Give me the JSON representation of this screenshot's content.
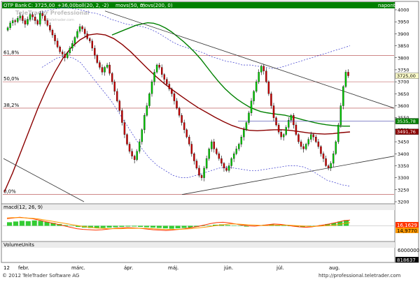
{
  "header": {
    "instrument": "OTP Bank",
    "close_text": "C: 3725,00",
    "change_text": "+36,00",
    "boll_text": "boll(20, 2, -2)",
    "movs_text": "movs(50, 0)",
    "movs2_text": "movs(200, 0)",
    "period": "naponta"
  },
  "watermark": {
    "line1": "TeleTrader Professional",
    "line2": "http://professional.teletrader.com"
  },
  "colors": {
    "background": "#ffffff",
    "header_bar": "#008000",
    "header_text": "#ffffff",
    "up_candle": "#00cc00",
    "down_candle": "#cc0000",
    "ma50": "#008000",
    "ma200": "#8b0000",
    "bollinger": "#3333cc",
    "trendline": "#333333",
    "macd": "#ff3300",
    "macd_signal": "#ff9900",
    "macd_hist": "#33cc33",
    "price_label_bg": "#ffffcc"
  },
  "fib_labels": [
    "61,8%",
    "50,0%",
    "38,2%",
    "0,0%"
  ],
  "price_tags": [
    {
      "text": "3725,00",
      "bg": "#ffffcc",
      "color": "#000000"
    },
    {
      "text": "3535,78",
      "bg": "#008000",
      "color": "#ffffff"
    },
    {
      "text": "3491,76",
      "bg": "#8b0000",
      "color": "#ffffff"
    }
  ],
  "macd_panel": {
    "label": "macd(12, 26, 9)",
    "tag1": "16,1629",
    "tag2": "14,9770"
  },
  "volume_panel": {
    "label": "VolumeUnits",
    "axis_top": "6000000",
    "tag": "818637"
  },
  "x_axis_labels": [
    "12",
    "febr.",
    "márc.",
    "ápr.",
    "máj.",
    "jún.",
    "júl.",
    "aug."
  ],
  "footer": {
    "left": "© 2012 TeleTrader Software AG",
    "right": "http://professional.teletrader.com"
  },
  "chart_data": {
    "type": "candlestick",
    "title": "OTP Bank",
    "ylim": [
      3200,
      4000
    ],
    "y_ticks": [
      3200,
      3250,
      3300,
      3350,
      3400,
      3450,
      3500,
      3550,
      3600,
      3650,
      3700,
      3750,
      3800,
      3850,
      3900,
      3950,
      4000
    ],
    "fib_levels": [
      {
        "label": "61,8%",
        "value": 3810
      },
      {
        "label": "50,0%",
        "value": 3700
      },
      {
        "label": "38,2%",
        "value": 3590
      },
      {
        "label": "0,0%",
        "value": 3230
      }
    ],
    "close_series": [
      3925,
      3945,
      3955,
      3950,
      3965,
      3975,
      3955,
      3940,
      3960,
      3980,
      3970,
      3955,
      3940,
      3985,
      3975,
      3955,
      3935,
      3915,
      3895,
      3870,
      3845,
      3825,
      3815,
      3800,
      3820,
      3840,
      3860,
      3885,
      3910,
      3930,
      3920,
      3900,
      3880,
      3870,
      3840,
      3810,
      3780,
      3760,
      3740,
      3760,
      3770,
      3735,
      3700,
      3660,
      3620,
      3580,
      3530,
      3480,
      3440,
      3410,
      3390,
      3375,
      3410,
      3450,
      3500,
      3560,
      3600,
      3650,
      3700,
      3740,
      3770,
      3760,
      3730,
      3710,
      3690,
      3670,
      3650,
      3620,
      3590,
      3560,
      3530,
      3500,
      3470,
      3440,
      3400,
      3370,
      3340,
      3310,
      3300,
      3340,
      3380,
      3420,
      3450,
      3420,
      3400,
      3380,
      3360,
      3340,
      3330,
      3350,
      3380,
      3400,
      3420,
      3440,
      3470,
      3500,
      3530,
      3570,
      3620,
      3660,
      3700,
      3740,
      3765,
      3745,
      3700,
      3650,
      3600,
      3550,
      3520,
      3490,
      3470,
      3480,
      3510,
      3540,
      3560,
      3520,
      3480,
      3450,
      3430,
      3420,
      3440,
      3460,
      3480,
      3470,
      3450,
      3430,
      3400,
      3380,
      3350,
      3340,
      3360,
      3400,
      3450,
      3520,
      3600,
      3680,
      3740,
      3725
    ],
    "ma50": [
      3895,
      3905,
      3915,
      3925,
      3935,
      3941,
      3946,
      3944,
      3936,
      3924,
      3908,
      3888,
      3868,
      3845,
      3820,
      3792,
      3760,
      3728,
      3698,
      3671,
      3648,
      3628,
      3611,
      3596,
      3585,
      3576,
      3571,
      3567,
      3564,
      3561,
      3555,
      3549,
      3542,
      3536,
      3530,
      3525,
      3521,
      3518,
      3516,
      3515,
      3515
    ],
    "ma200": [
      3240,
      3320,
      3410,
      3500,
      3590,
      3670,
      3740,
      3800,
      3845,
      3875,
      3895,
      3900,
      3895,
      3880,
      3855,
      3825,
      3790,
      3755,
      3722,
      3692,
      3665,
      3640,
      3615,
      3592,
      3572,
      3552,
      3534,
      3518,
      3506,
      3498,
      3496,
      3498,
      3500,
      3500,
      3497,
      3492,
      3487,
      3484,
      3482,
      3484,
      3488,
      3491
    ],
    "bollinger_upper": [
      3990,
      4000,
      4005,
      4010,
      4005,
      4000,
      3990,
      3985,
      3975,
      3960,
      3950,
      3940,
      3935,
      3930,
      3920,
      3905,
      3885,
      3865,
      3850,
      3840,
      3830,
      3820,
      3805,
      3795,
      3785,
      3780,
      3770,
      3770,
      3765,
      3760,
      3755,
      3760,
      3770,
      3780,
      3790,
      3800,
      3810,
      3820,
      3830,
      3840,
      3850
    ],
    "bollinger_lower": [
      3760,
      3780,
      3800,
      3805,
      3800,
      3780,
      3740,
      3700,
      3660,
      3620,
      3570,
      3520,
      3470,
      3420,
      3380,
      3350,
      3330,
      3310,
      3300,
      3300,
      3310,
      3320,
      3330,
      3340,
      3345,
      3340,
      3335,
      3330,
      3330,
      3335,
      3340,
      3345,
      3350,
      3350,
      3345,
      3330,
      3310,
      3290,
      3280,
      3270,
      3265
    ],
    "trendlines": [
      {
        "name": "upper",
        "from": 3995,
        "to": 3590
      },
      {
        "name": "lower",
        "from": 3230,
        "to": 3390
      }
    ],
    "last_close": 3725,
    "macd_ylim": [
      -40,
      40
    ],
    "macd_hist": [
      10,
      12,
      14,
      13,
      15,
      14,
      11,
      8,
      5,
      2,
      -1,
      -3,
      -5,
      -6,
      -7,
      -6,
      -5,
      -4,
      -3,
      -2,
      -2,
      -3,
      -4,
      -5,
      -6,
      -7,
      -8,
      -7,
      -6,
      -5,
      -3,
      -1,
      1,
      3,
      4,
      2,
      0,
      -1,
      -2,
      -1,
      1,
      3,
      4,
      3,
      1,
      -1,
      -2,
      -3,
      -2,
      0,
      2,
      5,
      8,
      12,
      16
    ],
    "macd_line": [
      20,
      22,
      24,
      22,
      20,
      16,
      12,
      8,
      4,
      0,
      -4,
      -8,
      -10,
      -11,
      -12,
      -11,
      -9,
      -7,
      -6,
      -5,
      -6,
      -7,
      -9,
      -11,
      -12,
      -13,
      -12,
      -10,
      -8,
      -5,
      -2,
      2,
      6,
      9,
      10,
      8,
      5,
      2,
      0,
      -1,
      1,
      3,
      5,
      4,
      2,
      -1,
      -3,
      -4,
      -3,
      0,
      3,
      6,
      10,
      14,
      16
    ],
    "macd_signal": [
      22,
      23,
      23,
      22,
      21,
      19,
      16,
      13,
      10,
      7,
      4,
      1,
      -2,
      -4,
      -6,
      -7,
      -8,
      -8,
      -8,
      -7,
      -7,
      -7,
      -7,
      -8,
      -9,
      -10,
      -10,
      -10,
      -9,
      -8,
      -6,
      -4,
      -2,
      1,
      3,
      5,
      5,
      4,
      3,
      2,
      1,
      1,
      2,
      2,
      2,
      1,
      0,
      -1,
      -2,
      -1,
      0,
      1,
      3,
      6,
      9
    ]
  }
}
